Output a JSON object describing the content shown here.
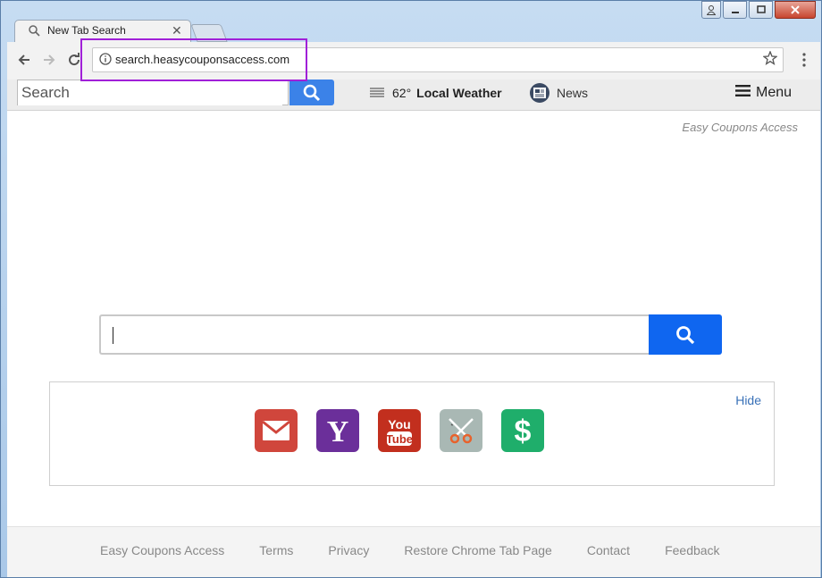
{
  "browser": {
    "tab_title": "New Tab Search",
    "url": "search.heasycouponsaccess.com",
    "icons": [
      "back-icon",
      "forward-icon",
      "reload-icon",
      "info-icon",
      "star-icon",
      "kebab-icon",
      "minimize-icon",
      "maximize-icon",
      "close-icon",
      "user-icon"
    ]
  },
  "topbar": {
    "search_placeholder": "Search",
    "weather_temp": "62°",
    "weather_label": "Local Weather",
    "news_label": "News",
    "menu_label": "Menu"
  },
  "brand": "Easy Coupons Access",
  "quicklinks": {
    "hide_label": "Hide",
    "tiles": [
      {
        "name": "gmail",
        "color": "#d0463c"
      },
      {
        "name": "yahoo",
        "color": "#6b2f9a"
      },
      {
        "name": "youtube",
        "color": "#c22f1e"
      },
      {
        "name": "coupons",
        "color": "#a9b8b4"
      },
      {
        "name": "money",
        "color": "#1fae6b"
      }
    ]
  },
  "footer": {
    "links": [
      "Easy Coupons Access",
      "Terms",
      "Privacy",
      "Restore Chrome Tab Page",
      "Contact",
      "Feedback"
    ]
  },
  "colors": {
    "accent": "#0f66f0",
    "top_search_button": "#3b82e8",
    "highlight": "#a020d8"
  }
}
